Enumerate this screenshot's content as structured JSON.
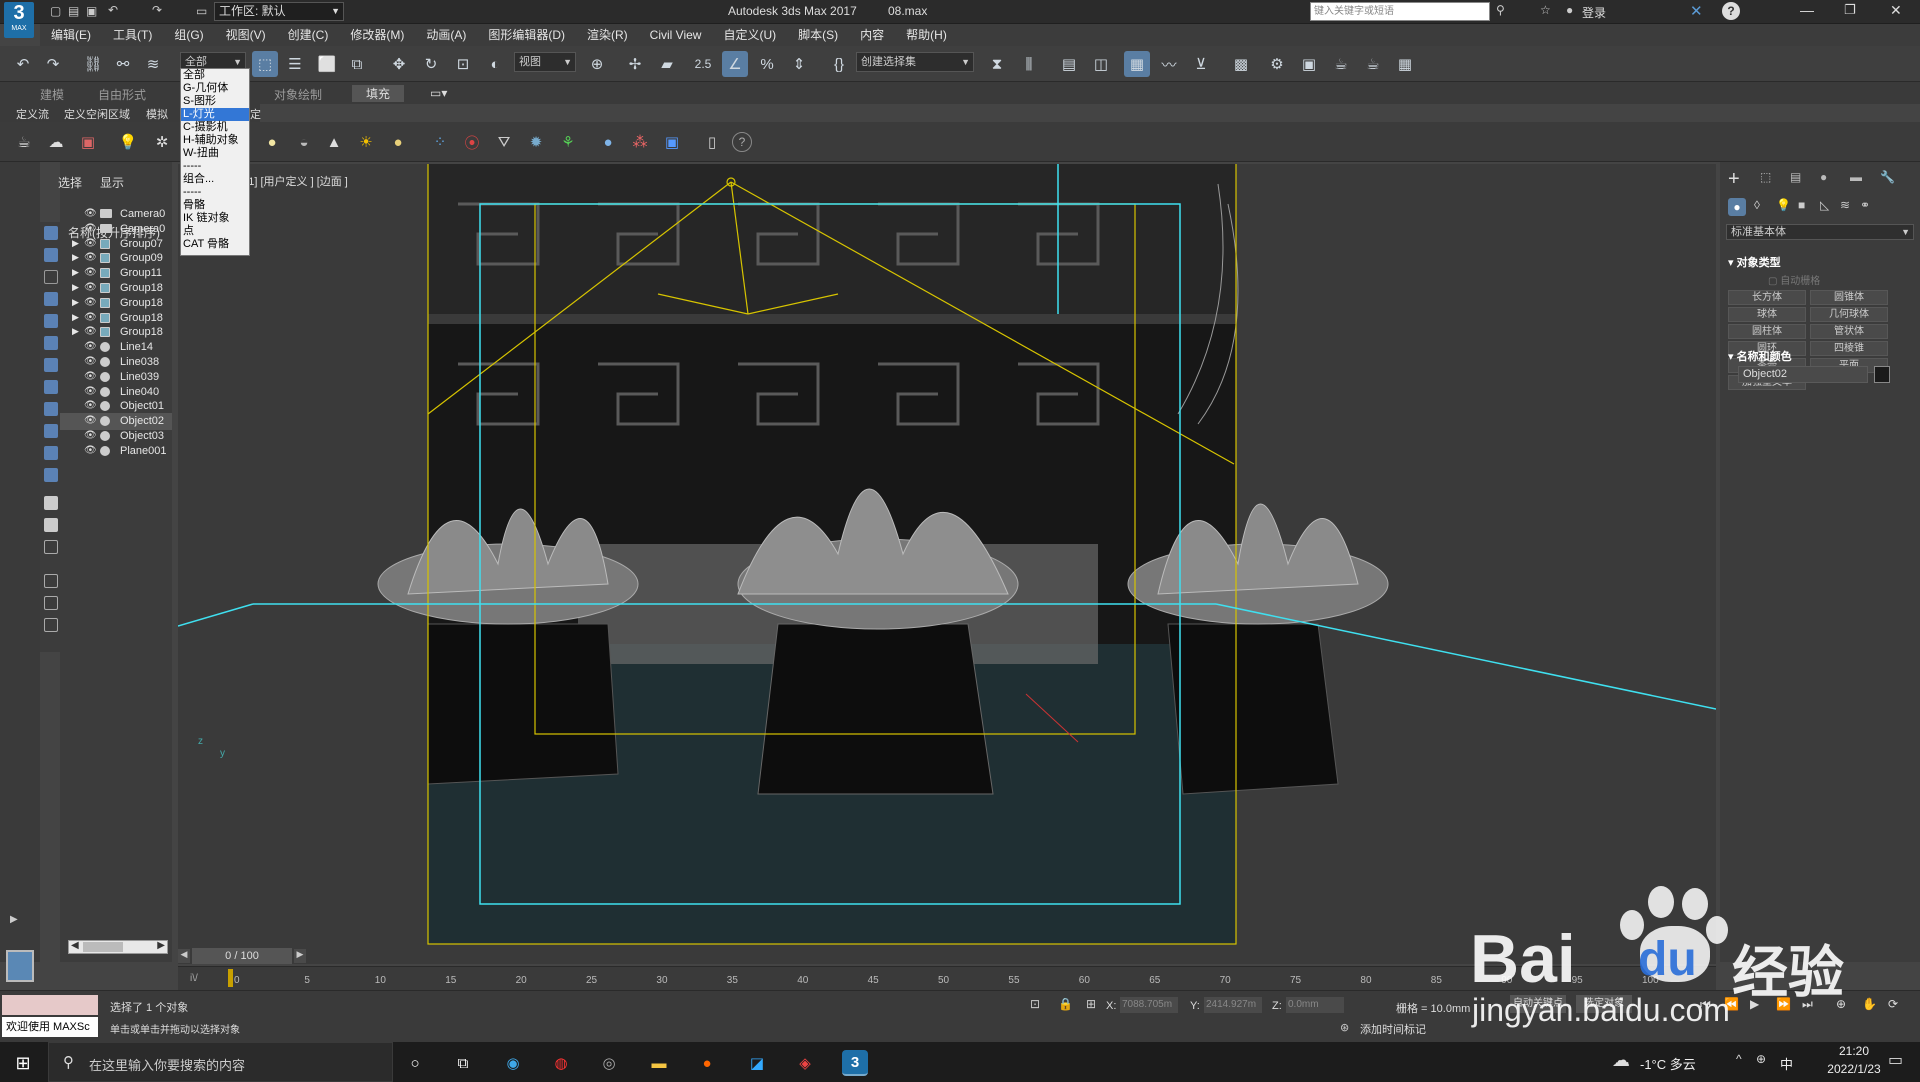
{
  "titlebar": {
    "logo_text": "3",
    "logo_sub": "MAX",
    "workspace_label": "工作区: 默认",
    "app_title": "Autodesk 3ds Max 2017",
    "file_name": "08.max",
    "search_placeholder": "键入关键字或短语",
    "login_label": "登录",
    "help_icon_text": "?"
  },
  "menu": [
    "编辑(E)",
    "工具(T)",
    "组(G)",
    "视图(V)",
    "创建(C)",
    "修改器(M)",
    "动画(A)",
    "图形编辑器(D)",
    "渲染(R)",
    "Civil View",
    "自定义(U)",
    "脚本(S)",
    "内容",
    "帮助(H)"
  ],
  "toolbar": {
    "filter_value": "全部",
    "view_value": "视图",
    "snap_labels": [
      "2.5",
      "%"
    ],
    "selection_set_value": "创建选择集"
  },
  "filter_dropdown": {
    "options": [
      "全部",
      "G-几何体",
      "S-图形",
      "L-灯光",
      "C-摄影机",
      "H-辅助对象",
      "W-扭曲",
      "-----",
      "组合...",
      "-----",
      "骨骼",
      "IK 链对象",
      "点",
      "CAT 骨骼"
    ],
    "selected_index": 3
  },
  "ribbon": {
    "tabs": [
      "建模",
      "自由形式",
      "对象绘制",
      "填充"
    ],
    "subtabs": [
      "定义流",
      "定义空闲区域",
      "模拟",
      "定对象"
    ]
  },
  "scene_explorer": {
    "tabs": [
      "选择",
      "显示"
    ],
    "header": "名称(按升序排序)",
    "items": [
      {
        "name": "Camera0",
        "type": "camera",
        "expandable": false
      },
      {
        "name": "Camera0",
        "type": "camera",
        "expandable": false
      },
      {
        "name": "Group07",
        "type": "group",
        "expandable": true
      },
      {
        "name": "Group09",
        "type": "group",
        "expandable": true
      },
      {
        "name": "Group11",
        "type": "group",
        "expandable": true
      },
      {
        "name": "Group18",
        "type": "group",
        "expandable": true
      },
      {
        "name": "Group18",
        "type": "group",
        "expandable": true
      },
      {
        "name": "Group18",
        "type": "group",
        "expandable": true
      },
      {
        "name": "Group18",
        "type": "group",
        "expandable": true
      },
      {
        "name": "Line14",
        "type": "object",
        "expandable": false
      },
      {
        "name": "Line038",
        "type": "object",
        "expandable": false
      },
      {
        "name": "Line039",
        "type": "object",
        "expandable": false
      },
      {
        "name": "Line040",
        "type": "object",
        "expandable": false
      },
      {
        "name": "Object01",
        "type": "object",
        "expandable": false
      },
      {
        "name": "Object02",
        "type": "object",
        "expandable": false
      },
      {
        "name": "Object03",
        "type": "object",
        "expandable": false
      },
      {
        "name": "Plane001",
        "type": "object",
        "expandable": false
      }
    ]
  },
  "viewport": {
    "label": "001] [用户定义 ] [边面 ]",
    "axis_labels": [
      "z",
      "y"
    ]
  },
  "command_panel": {
    "category_value": "标准基本体",
    "section_object_type": "对象类型",
    "autogrid_label": "自动栅格",
    "buttons": [
      "长方体",
      "圆锥体",
      "球体",
      "几何球体",
      "圆柱体",
      "管状体",
      "圆环",
      "四棱锥",
      "茶壶",
      "平面",
      "加强型文本"
    ],
    "section_name_color": "名称和颜色",
    "object_name": "Object02",
    "color_swatch": "#1a1a1a"
  },
  "timeline": {
    "frame_label": "0 / 100",
    "ticks": [
      "0",
      "5",
      "10",
      "15",
      "20",
      "25",
      "30",
      "35",
      "40",
      "45",
      "50",
      "55",
      "60",
      "65",
      "70",
      "75",
      "80",
      "85",
      "90",
      "95",
      "100"
    ]
  },
  "status": {
    "maxscript_label": "欢迎使用 MAXSc",
    "selected_text": "选择了 1 个对象",
    "hint_text": "单击或单击并拖动以选择对象",
    "x_label": "X:",
    "x_value": "7088.705m",
    "y_label": "Y:",
    "y_value": "2414.927m",
    "z_label": "Z:",
    "z_value": "0.0mm",
    "grid_text": "栅格 = 10.0mm",
    "add_time_tag": "添加时间标记",
    "autokey_label": "自动关键点",
    "setkey_label": "选定对象"
  },
  "taskbar": {
    "search_placeholder": "在这里输入你要搜索的内容",
    "weather": "-1°C 多云",
    "ime_label": "中",
    "time": "21:20",
    "date": "2022/1/23"
  },
  "watermark": {
    "brand": "Bai",
    "brand2": "du",
    "suffix": "经验",
    "url": "jingyan.baidu.com"
  },
  "colors": {
    "accent_blue": "#5a7ea3",
    "selection_yellow": "#d7c400",
    "camera_cyan": "#3fe0f0",
    "panel_bg": "#3c3c3c"
  }
}
